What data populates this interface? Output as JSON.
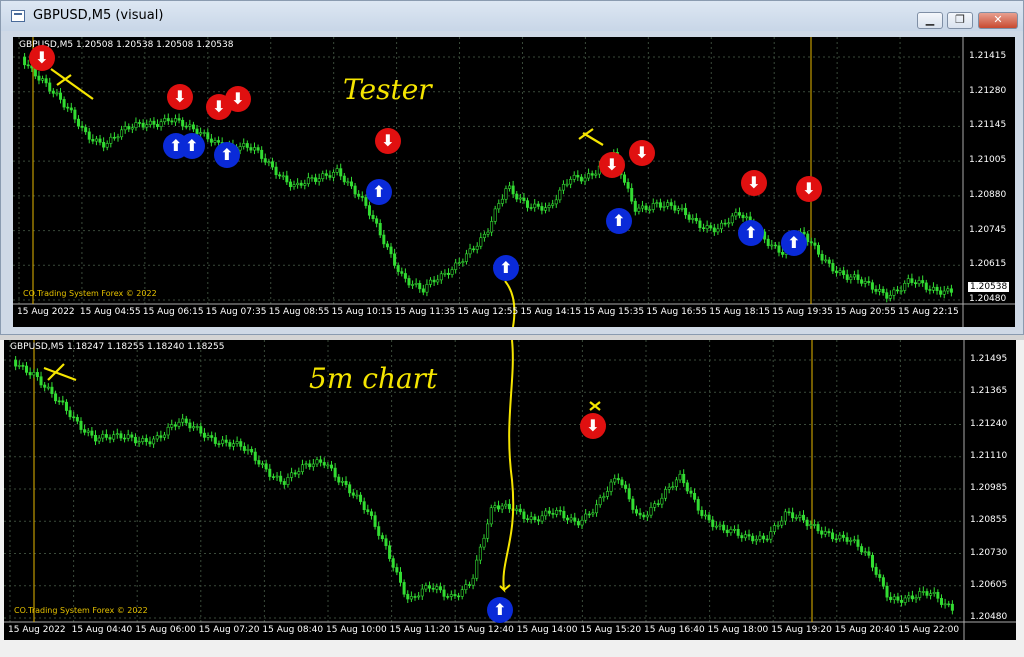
{
  "window": {
    "title": "GBPUSD,M5 (visual)",
    "minimize_label": "▁",
    "maximize_label": "❐",
    "close_label": "✕"
  },
  "tester": {
    "header": "GBPUSD,M5  1.20508 1.20538 1.20508 1.20538",
    "copyright": "CO.Trading System Forex © 2022",
    "price_box": "1.20538",
    "yaxis": [
      "1.21415",
      "1.21280",
      "1.21145",
      "1.21005",
      "1.20880",
      "1.20745",
      "1.20615",
      "1.20480"
    ],
    "xaxis": [
      "15 Aug 2022",
      "15 Aug 04:55",
      "15 Aug 06:15",
      "15 Aug 07:35",
      "15 Aug 08:55",
      "15 Aug 10:15",
      "15 Aug 11:35",
      "15 Aug 12:55",
      "15 Aug 14:15",
      "15 Aug 15:35",
      "15 Aug 16:55",
      "15 Aug 18:15",
      "15 Aug 19:35",
      "15 Aug 20:55",
      "15 Aug 22:15"
    ],
    "annotation": "Tester"
  },
  "live": {
    "header": "GBPUSD,M5  1.18247 1.18255 1.18240 1.18255",
    "copyright": "CO.Trading System Forex © 2022",
    "yaxis": [
      "1.21495",
      "1.21365",
      "1.21240",
      "1.21110",
      "1.20985",
      "1.20855",
      "1.20730",
      "1.20605",
      "1.20480"
    ],
    "xaxis": [
      "15 Aug 2022",
      "15 Aug 04:40",
      "15 Aug 06:00",
      "15 Aug 07:20",
      "15 Aug 08:40",
      "15 Aug 10:00",
      "15 Aug 11:20",
      "15 Aug 12:40",
      "15 Aug 14:00",
      "15 Aug 15:20",
      "15 Aug 16:40",
      "15 Aug 18:00",
      "15 Aug 19:20",
      "15 Aug 20:40",
      "15 Aug 22:00"
    ],
    "annotation": "5m chart"
  },
  "colors": {
    "candle": "#33dd33",
    "grid": "#3a4a3a",
    "vline": "#e6b800",
    "annotation": "#f5e500",
    "buy": "#0a2ad8",
    "sell": "#e01010"
  },
  "icons": {
    "buy_signal": "arrow-up-circle-icon",
    "sell_signal": "arrow-down-circle-icon",
    "up_glyph": "⬆",
    "down_glyph": "⬇"
  }
}
